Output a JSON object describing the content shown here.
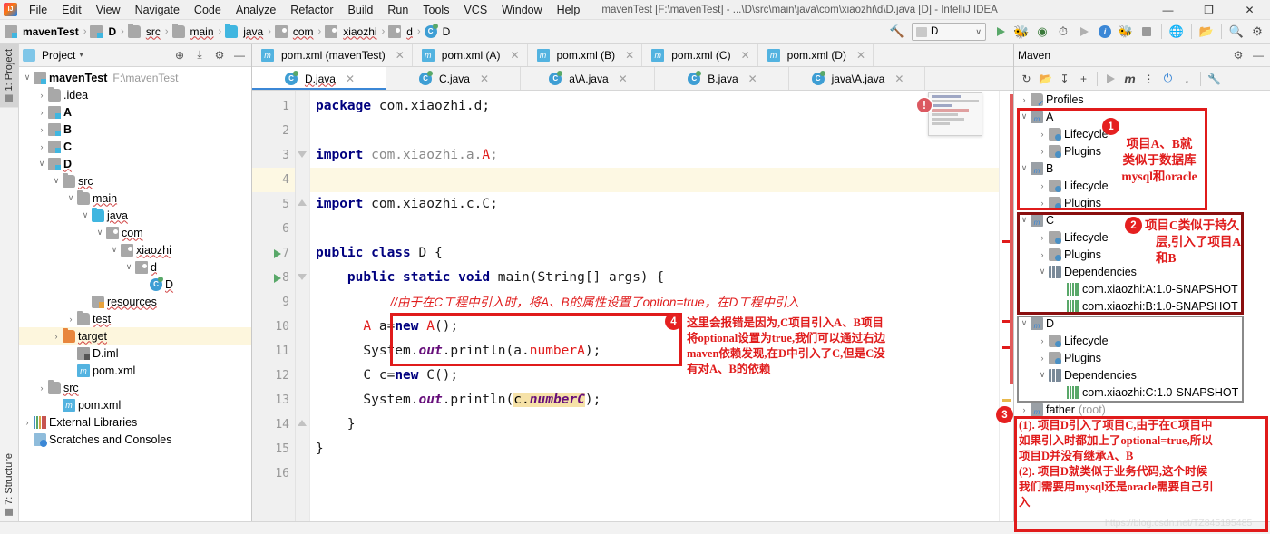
{
  "titlebar": {
    "logo_alt": "intellij-logo",
    "menus": [
      "File",
      "Edit",
      "View",
      "Navigate",
      "Code",
      "Analyze",
      "Refactor",
      "Build",
      "Run",
      "Tools",
      "VCS",
      "Window",
      "Help"
    ],
    "window_title": "mavenTest [F:\\mavenTest] - ...\\D\\src\\main\\java\\com\\xiaozhi\\d\\D.java [D] - IntelliJ IDEA",
    "minimize": "—",
    "maximize": "❐",
    "close": "✕"
  },
  "navbar": {
    "crumbs": [
      {
        "label": "mavenTest",
        "icon": "module-icon",
        "bold": true
      },
      {
        "label": "D",
        "icon": "module-icon",
        "bold": true
      },
      {
        "label": "src",
        "icon": "folder-icon",
        "bold": false
      },
      {
        "label": "main",
        "icon": "folder-icon",
        "bold": false
      },
      {
        "label": "java",
        "icon": "source-folder-icon",
        "bold": false
      },
      {
        "label": "com",
        "icon": "package-icon",
        "bold": false
      },
      {
        "label": "xiaozhi",
        "icon": "package-icon",
        "bold": false
      },
      {
        "label": "d",
        "icon": "package-icon",
        "bold": false
      },
      {
        "label": "D",
        "icon": "class-icon",
        "bold": false
      }
    ],
    "separator": "›",
    "run_config": "D",
    "chevron": "∨"
  },
  "left_rail": {
    "top_tab": "1: Project",
    "bottom_tab": "7: Structure"
  },
  "project_panel": {
    "title": "Project",
    "dropdown": "▾",
    "locate_icon": "⊕",
    "collapse_icon": "⤓",
    "settings_icon": "⚙",
    "hide_icon": "—",
    "tree": [
      {
        "label": "mavenTest",
        "path": "F:\\mavenTest",
        "indent": 0,
        "arrow": "∨",
        "icon": "module-icon",
        "bold": true,
        "selected": false
      },
      {
        "label": ".idea",
        "path": "",
        "indent": 1,
        "arrow": "›",
        "icon": "folder-icon",
        "bold": false,
        "selected": false
      },
      {
        "label": "A",
        "path": "",
        "indent": 1,
        "arrow": "›",
        "icon": "module-icon",
        "bold": true,
        "selected": false
      },
      {
        "label": "B",
        "path": "",
        "indent": 1,
        "arrow": "›",
        "icon": "module-icon",
        "bold": true,
        "selected": false
      },
      {
        "label": "C",
        "path": "",
        "indent": 1,
        "arrow": "›",
        "icon": "module-icon",
        "bold": true,
        "selected": false
      },
      {
        "label": "D",
        "path": "",
        "indent": 1,
        "arrow": "∨",
        "icon": "module-icon",
        "bold": true,
        "selected": false
      },
      {
        "label": "src",
        "path": "",
        "indent": 2,
        "arrow": "∨",
        "icon": "folder-icon",
        "bold": false,
        "selected": false
      },
      {
        "label": "main",
        "path": "",
        "indent": 3,
        "arrow": "∨",
        "icon": "folder-icon",
        "bold": false,
        "selected": false
      },
      {
        "label": "java",
        "path": "",
        "indent": 4,
        "arrow": "∨",
        "icon": "source-folder-icon",
        "bold": false,
        "selected": false
      },
      {
        "label": "com",
        "path": "",
        "indent": 5,
        "arrow": "∨",
        "icon": "package-icon",
        "bold": false,
        "selected": false
      },
      {
        "label": "xiaozhi",
        "path": "",
        "indent": 6,
        "arrow": "∨",
        "icon": "package-icon",
        "bold": false,
        "selected": false
      },
      {
        "label": "d",
        "path": "",
        "indent": 7,
        "arrow": "∨",
        "icon": "package-icon",
        "bold": false,
        "selected": false
      },
      {
        "label": "D",
        "path": "",
        "indent": 8,
        "arrow": "",
        "icon": "class-icon",
        "bold": false,
        "selected": false
      },
      {
        "label": "resources",
        "path": "",
        "indent": 4,
        "arrow": "",
        "icon": "resources-folder-icon",
        "bold": false,
        "selected": false
      },
      {
        "label": "test",
        "path": "",
        "indent": 3,
        "arrow": "›",
        "icon": "folder-icon",
        "bold": false,
        "selected": false
      },
      {
        "label": "target",
        "path": "",
        "indent": 2,
        "arrow": "›",
        "icon": "target-folder-icon",
        "bold": false,
        "selected": true
      },
      {
        "label": "D.iml",
        "path": "",
        "indent": 3,
        "arrow": "",
        "icon": "iml-icon",
        "bold": false,
        "selected": false
      },
      {
        "label": "pom.xml",
        "path": "",
        "indent": 3,
        "arrow": "",
        "icon": "maven-xml-icon",
        "bold": false,
        "selected": false
      },
      {
        "label": "src",
        "path": "",
        "indent": 1,
        "arrow": "›",
        "icon": "folder-icon",
        "bold": false,
        "selected": false
      },
      {
        "label": "pom.xml",
        "path": "",
        "indent": 2,
        "arrow": "",
        "icon": "maven-xml-icon",
        "bold": false,
        "selected": false
      },
      {
        "label": "External Libraries",
        "path": "",
        "indent": 0,
        "arrow": "›",
        "icon": "library-icon",
        "bold": false,
        "selected": false
      },
      {
        "label": "Scratches and Consoles",
        "path": "",
        "indent": 0,
        "arrow": "",
        "icon": "scratches-icon",
        "bold": false,
        "selected": false
      }
    ]
  },
  "editor": {
    "tabs_row1": [
      {
        "label": "pom.xml (mavenTest)",
        "icon": "maven-xml-icon",
        "active": false
      },
      {
        "label": "pom.xml (A)",
        "icon": "maven-xml-icon",
        "active": false
      },
      {
        "label": "pom.xml (B)",
        "icon": "maven-xml-icon",
        "active": false
      },
      {
        "label": "pom.xml (C)",
        "icon": "maven-xml-icon",
        "active": false
      },
      {
        "label": "pom.xml (D)",
        "icon": "maven-xml-icon",
        "active": false
      }
    ],
    "tabs_row2": [
      {
        "label": "D.java",
        "icon": "class-icon",
        "active": true
      },
      {
        "label": "C.java",
        "icon": "class-icon",
        "active": false
      },
      {
        "label": "a\\A.java",
        "icon": "class-icon",
        "active": false
      },
      {
        "label": "B.java",
        "icon": "class-icon",
        "active": false
      },
      {
        "label": "java\\A.java",
        "icon": "class-icon",
        "active": false
      }
    ],
    "close_glyph": "✕",
    "line_numbers": [
      "1",
      "2",
      "3",
      "4",
      "5",
      "6",
      "7",
      "8",
      "9",
      "10",
      "11",
      "12",
      "13",
      "14",
      "15",
      "16"
    ],
    "lines": [
      {
        "n": "1",
        "text": "package com.xiaozhi.d;"
      },
      {
        "n": "2",
        "text": ""
      },
      {
        "n": "3",
        "text": "import com.xiaozhi.a.A;"
      },
      {
        "n": "4",
        "text": ""
      },
      {
        "n": "5",
        "text": "import com.xiaozhi.c.C;"
      },
      {
        "n": "6",
        "text": ""
      },
      {
        "n": "7",
        "text": "public class D {"
      },
      {
        "n": "8",
        "text": "    public static void main(String[] args) {"
      },
      {
        "n": "9",
        "text": "        //由于在C工程中引入时，将A、B的属性设置了option=true，在D工程中引入"
      },
      {
        "n": "10",
        "text": "        A a=new A();"
      },
      {
        "n": "11",
        "text": "        System.out.println(a.numberA);"
      },
      {
        "n": "12",
        "text": "        C c=new C();"
      },
      {
        "n": "13",
        "text": "        System.out.println(c.numberC);"
      },
      {
        "n": "14",
        "text": "    }"
      },
      {
        "n": "15",
        "text": "}"
      },
      {
        "n": "16",
        "text": ""
      }
    ]
  },
  "maven_panel": {
    "title": "Maven",
    "settings_icon": "⚙",
    "hide_icon": "—",
    "toolbar_icons": [
      "refresh-icon",
      "add-folder-icon",
      "download-icon",
      "plus-icon",
      "run-icon",
      "maven-goal-icon",
      "skip-tests-icon",
      "toggle-offline-icon",
      "collapse-all-icon",
      "settings-wrench-icon"
    ],
    "tree": [
      {
        "label": "Profiles",
        "indent": 0,
        "arrow": "›",
        "icon": "profiles-icon",
        "gray": ""
      },
      {
        "label": "A",
        "indent": 0,
        "arrow": "∨",
        "icon": "maven-project-icon",
        "gray": ""
      },
      {
        "label": "Lifecycle",
        "indent": 1,
        "arrow": "›",
        "icon": "lifecycle-icon",
        "gray": ""
      },
      {
        "label": "Plugins",
        "indent": 1,
        "arrow": "›",
        "icon": "plugins-icon",
        "gray": ""
      },
      {
        "label": "B",
        "indent": 0,
        "arrow": "∨",
        "icon": "maven-project-icon",
        "gray": ""
      },
      {
        "label": "Lifecycle",
        "indent": 1,
        "arrow": "›",
        "icon": "lifecycle-icon",
        "gray": ""
      },
      {
        "label": "Plugins",
        "indent": 1,
        "arrow": "›",
        "icon": "plugins-icon",
        "gray": ""
      },
      {
        "label": "C",
        "indent": 0,
        "arrow": "∨",
        "icon": "maven-project-icon",
        "gray": ""
      },
      {
        "label": "Lifecycle",
        "indent": 1,
        "arrow": "›",
        "icon": "lifecycle-icon",
        "gray": ""
      },
      {
        "label": "Plugins",
        "indent": 1,
        "arrow": "›",
        "icon": "plugins-icon",
        "gray": ""
      },
      {
        "label": "Dependencies",
        "indent": 1,
        "arrow": "∨",
        "icon": "dependencies-icon",
        "gray": ""
      },
      {
        "label": "com.xiaozhi:A:1.0-SNAPSHOT",
        "indent": 2,
        "arrow": "",
        "icon": "dependency-icon",
        "gray": ""
      },
      {
        "label": "com.xiaozhi:B:1.0-SNAPSHOT",
        "indent": 2,
        "arrow": "",
        "icon": "dependency-icon",
        "gray": ""
      },
      {
        "label": "D",
        "indent": 0,
        "arrow": "∨",
        "icon": "maven-project-icon",
        "gray": ""
      },
      {
        "label": "Lifecycle",
        "indent": 1,
        "arrow": "›",
        "icon": "lifecycle-icon",
        "gray": ""
      },
      {
        "label": "Plugins",
        "indent": 1,
        "arrow": "›",
        "icon": "plugins-icon",
        "gray": ""
      },
      {
        "label": "Dependencies",
        "indent": 1,
        "arrow": "∨",
        "icon": "dependencies-icon",
        "gray": ""
      },
      {
        "label": "com.xiaozhi:C:1.0-SNAPSHOT",
        "indent": 2,
        "arrow": "",
        "icon": "dependency-icon",
        "gray": ""
      },
      {
        "label": "father",
        "indent": 0,
        "arrow": "›",
        "icon": "maven-project-icon",
        "gray": "(root)"
      }
    ]
  },
  "annotations": {
    "badge1": "1",
    "badge2": "2",
    "badge3": "3",
    "badge4": "4",
    "note1_line1": "项目A、B就",
    "note1_line2": "类似于数据库",
    "note1_line3": "mysql和oracle",
    "note2_line1": "项目C类似于持久",
    "note2_line2": "层,引入了项目A",
    "note2_line3": "和B",
    "note3_line1": "(1). 项目D引入了项目C,由于在C项目中",
    "note3_line2": "如果引入时都加上了optional=true,所以",
    "note3_line3": "项目D并没有继承A、B",
    "note3_line4": "(2). 项目D就类似于业务代码,这个时候",
    "note3_line5": "我们需要用mysql还是oracle需要自己引",
    "note3_line6": "入",
    "note4_line1": "这里会报错是因为,C项目引入A、B项目",
    "note4_line2": "将optional设置为true,我们可以通过右边",
    "note4_line3": "maven依赖发现,在D中引入了C,但是C没",
    "note4_line4": "有对A、B的依赖",
    "watermark": "https://blog.csdn.net/TZ845195485"
  },
  "colors": {
    "annotation_red": "#e01b1b",
    "badge_red": "#e52020",
    "accent_blue": "#3b87d6",
    "selection_yellow": "#fdf6dd",
    "error_red": "#db5860"
  }
}
